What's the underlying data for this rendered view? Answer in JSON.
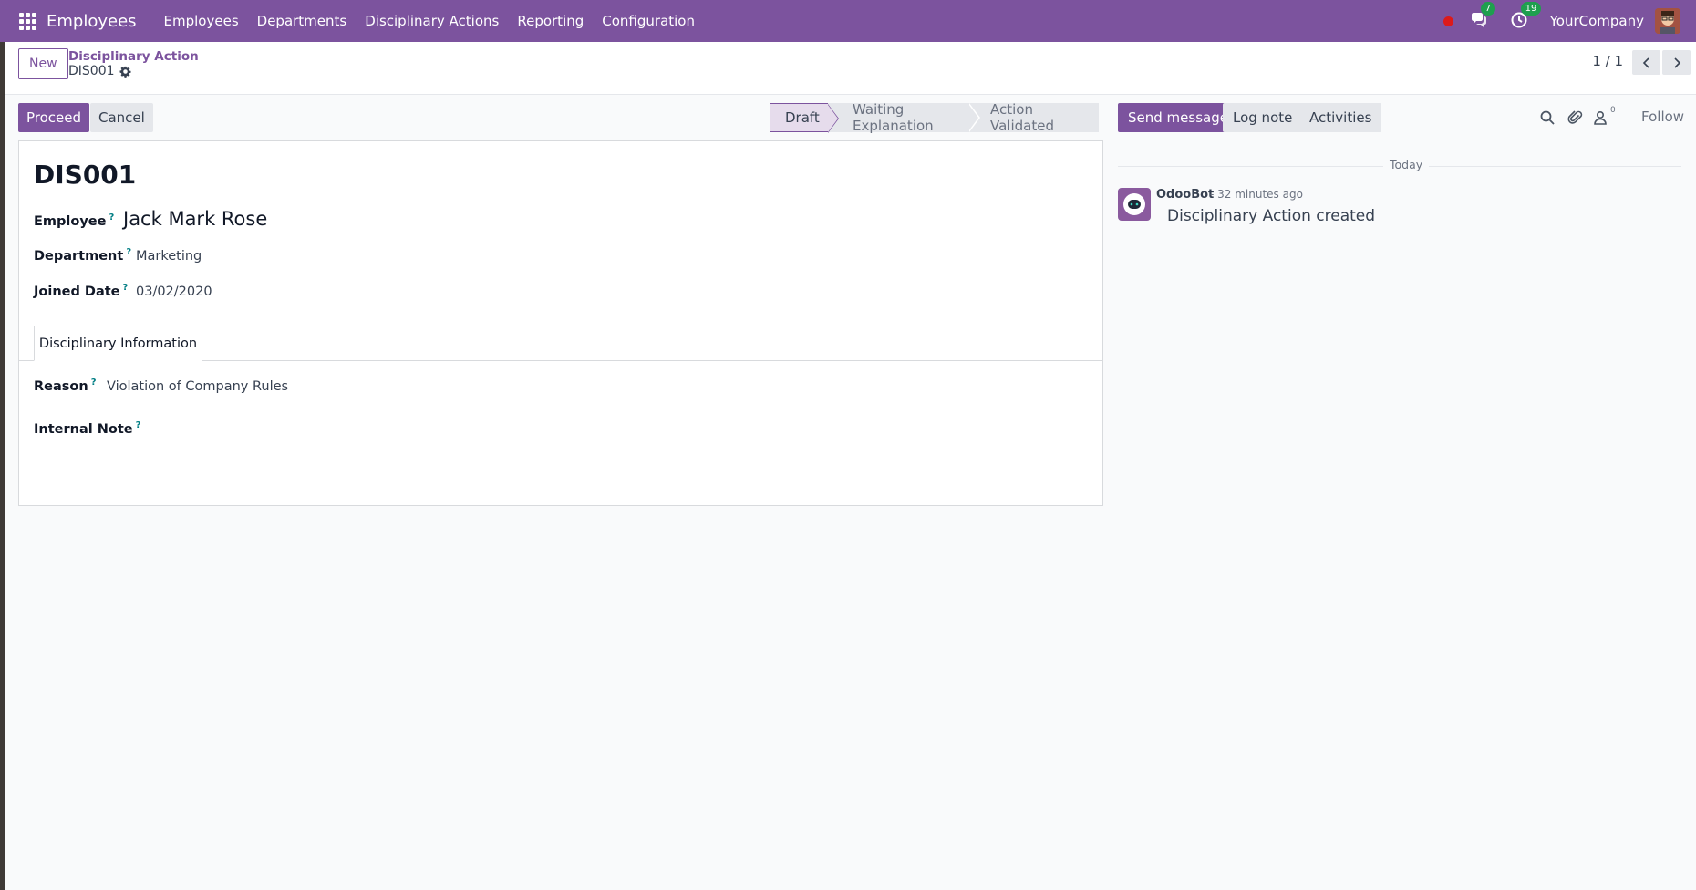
{
  "navbar": {
    "app_name": "Employees",
    "menu": [
      "Employees",
      "Departments",
      "Disciplinary Actions",
      "Reporting",
      "Configuration"
    ],
    "messages_badge": "7",
    "activities_badge": "19",
    "company": "YourCompany"
  },
  "control_panel": {
    "new_label": "New",
    "breadcrumb_parent": "Disciplinary Action",
    "breadcrumb_current": "DIS001",
    "pager": "1 / 1"
  },
  "actions": {
    "proceed": "Proceed",
    "cancel": "Cancel"
  },
  "status_stages": [
    {
      "label": "Draft",
      "active": true
    },
    {
      "label": "Waiting Explanation",
      "active": false
    },
    {
      "label": "Action Validated",
      "active": false
    }
  ],
  "form": {
    "title": "DIS001",
    "employee_label": "Employee",
    "employee_value": "Jack Mark Rose",
    "department_label": "Department",
    "department_value": "Marketing",
    "joined_label": "Joined Date",
    "joined_value": "03/02/2020",
    "tab_label": "Disciplinary Information",
    "reason_label": "Reason",
    "reason_value": "Violation of Company Rules",
    "internal_note_label": "Internal Note",
    "help_mark": "?"
  },
  "chatter": {
    "send_message": "Send message",
    "log_note": "Log note",
    "activities": "Activities",
    "followers_count": "0",
    "follow": "Follow",
    "day_label": "Today",
    "message": {
      "author": "OdooBot",
      "time": "- 32 minutes ago",
      "body": "Disciplinary Action created"
    }
  },
  "colors": {
    "brand": "#7c539e",
    "badge": "#1e9f4e",
    "recording": "#dc1a1a",
    "help": "#017e84"
  }
}
